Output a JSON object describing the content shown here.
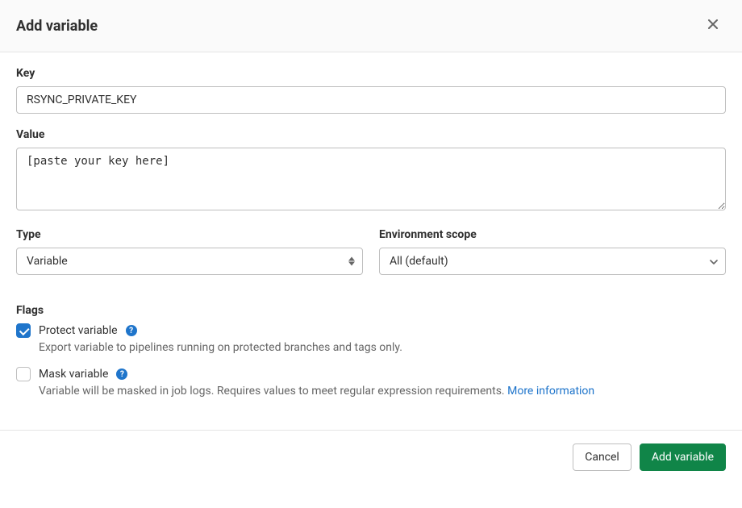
{
  "header": {
    "title": "Add variable"
  },
  "form": {
    "key": {
      "label": "Key",
      "value": "RSYNC_PRIVATE_KEY"
    },
    "value": {
      "label": "Value",
      "text": "[paste your key here]"
    },
    "type": {
      "label": "Type",
      "selected": "Variable"
    },
    "scope": {
      "label": "Environment scope",
      "selected": "All (default)"
    }
  },
  "flags": {
    "label": "Flags",
    "protect": {
      "label": "Protect variable",
      "description": "Export variable to pipelines running on protected branches and tags only.",
      "checked": true
    },
    "mask": {
      "label": "Mask variable",
      "description": "Variable will be masked in job logs. Requires values to meet regular expression requirements. ",
      "link_text": "More information",
      "checked": false
    }
  },
  "footer": {
    "cancel": "Cancel",
    "submit": "Add variable"
  }
}
